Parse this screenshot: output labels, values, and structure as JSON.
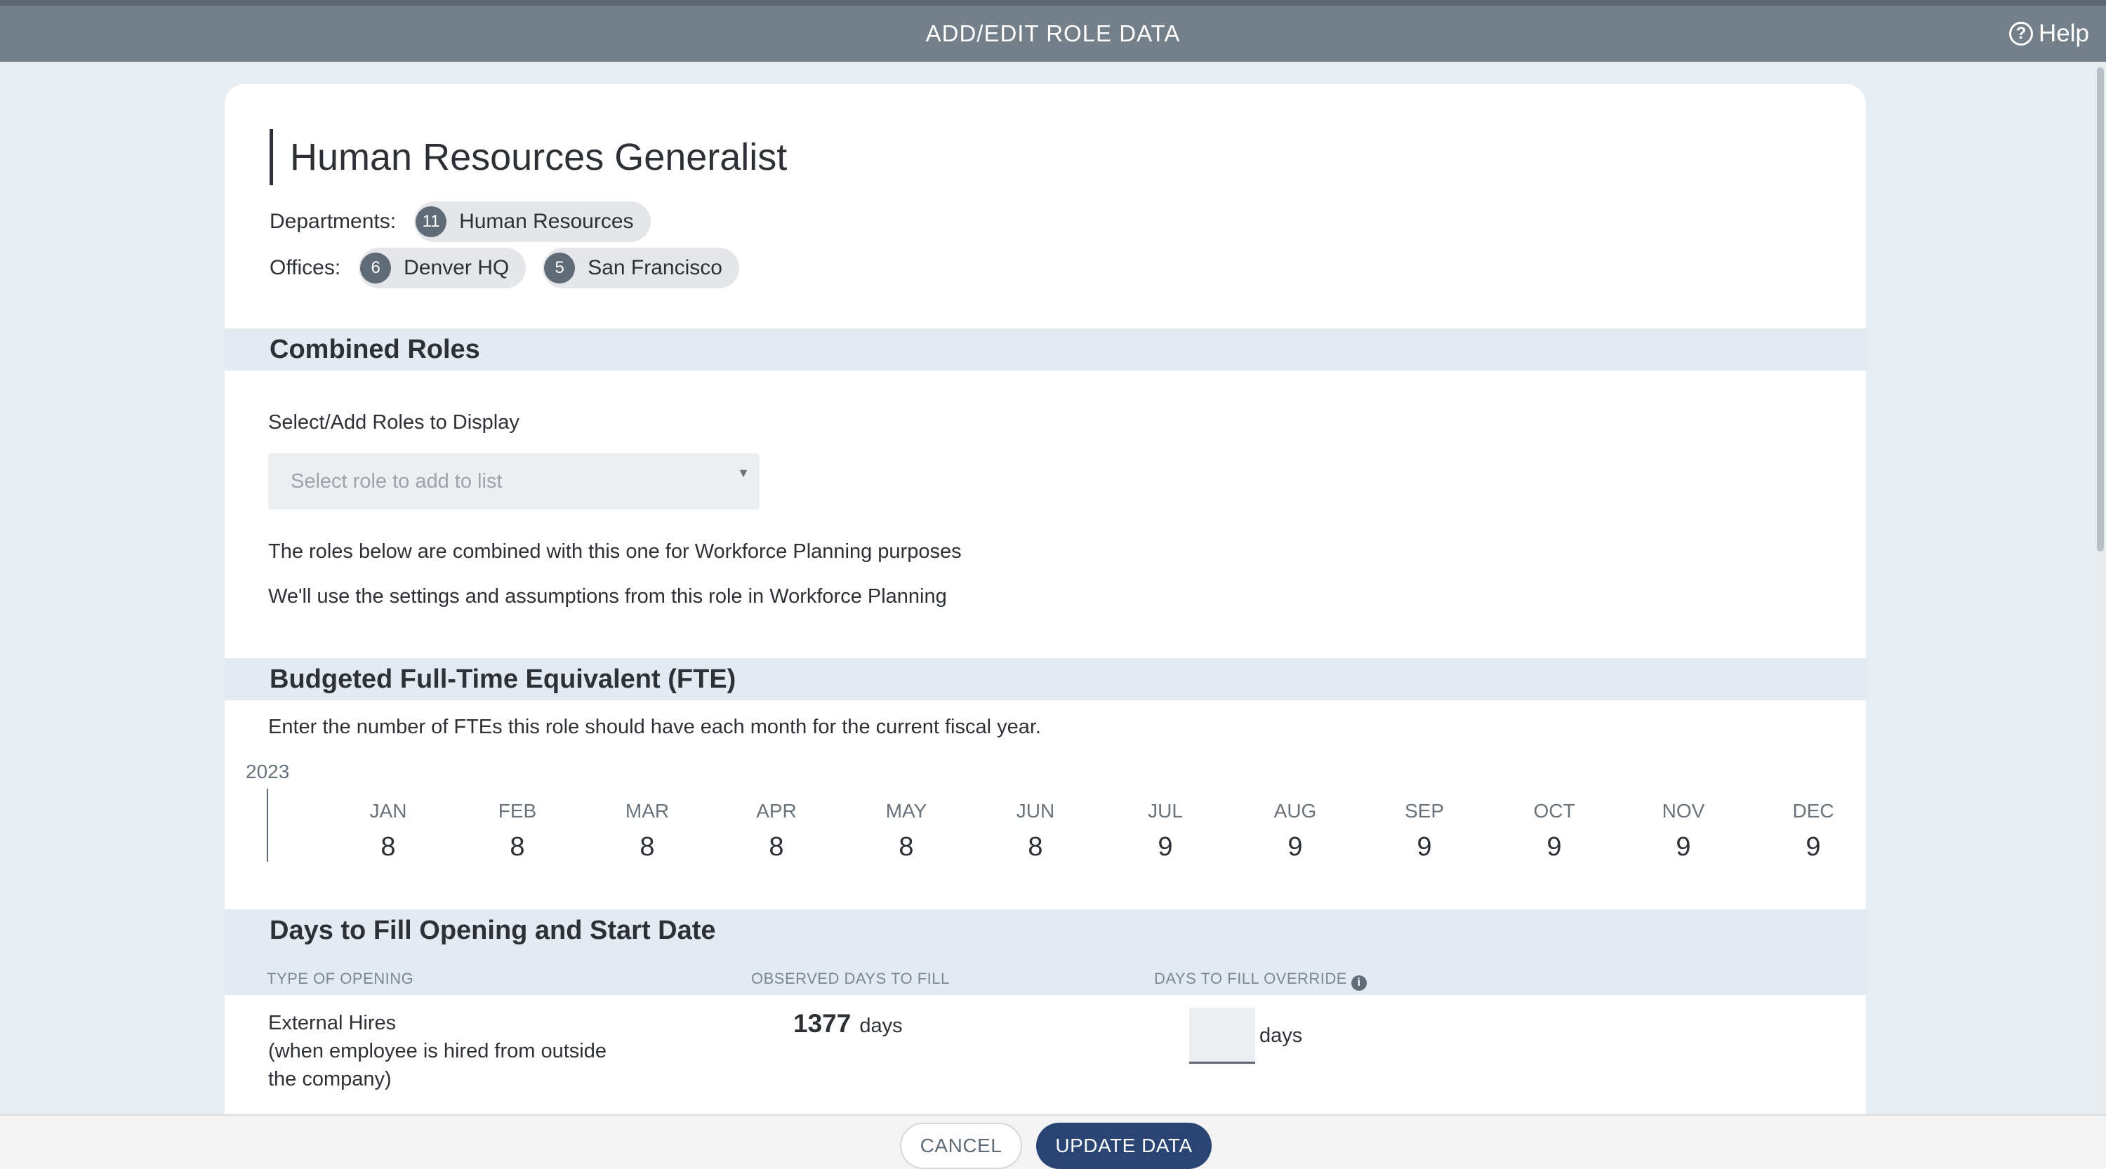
{
  "header": {
    "title": "ADD/EDIT ROLE DATA",
    "help_label": "Help"
  },
  "role": {
    "title": "Human Resources Generalist",
    "departments_label": "Departments:",
    "departments": [
      {
        "count": "11",
        "name": "Human Resources"
      }
    ],
    "offices_label": "Offices:",
    "offices": [
      {
        "count": "6",
        "name": "Denver HQ"
      },
      {
        "count": "5",
        "name": "San Francisco"
      }
    ]
  },
  "combined_roles": {
    "heading": "Combined Roles",
    "select_label": "Select/Add Roles to Display",
    "select_placeholder": "Select role to add to list",
    "note_1": "The roles below are combined with this one for Workforce Planning purposes",
    "note_2": "We'll use the settings and assumptions from this role in Workforce Planning"
  },
  "fte": {
    "heading": "Budgeted Full-Time Equivalent (FTE)",
    "description": "Enter the number of FTEs this role should have each month for the current fiscal year.",
    "year": "2023",
    "months": [
      {
        "name": "JAN",
        "value": "8"
      },
      {
        "name": "FEB",
        "value": "8"
      },
      {
        "name": "MAR",
        "value": "8"
      },
      {
        "name": "APR",
        "value": "8"
      },
      {
        "name": "MAY",
        "value": "8"
      },
      {
        "name": "JUN",
        "value": "8"
      },
      {
        "name": "JUL",
        "value": "9"
      },
      {
        "name": "AUG",
        "value": "9"
      },
      {
        "name": "SEP",
        "value": "9"
      },
      {
        "name": "OCT",
        "value": "9"
      },
      {
        "name": "NOV",
        "value": "9"
      },
      {
        "name": "DEC",
        "value": "9"
      }
    ]
  },
  "days_to_fill": {
    "heading": "Days to Fill Opening and Start Date",
    "columns": {
      "type": "TYPE OF OPENING",
      "observed": "OBSERVED DAYS TO FILL",
      "override": "DAYS TO FILL OVERRIDE"
    },
    "rows": [
      {
        "type_line1": "External Hires",
        "type_line2": "(when employee is hired from outside",
        "type_line3": "the company)",
        "observed_value": "1377",
        "observed_unit": "days",
        "override_value": "",
        "override_unit": "days"
      }
    ]
  },
  "footer": {
    "cancel_label": "CANCEL",
    "update_label": "UPDATE DATA"
  }
}
